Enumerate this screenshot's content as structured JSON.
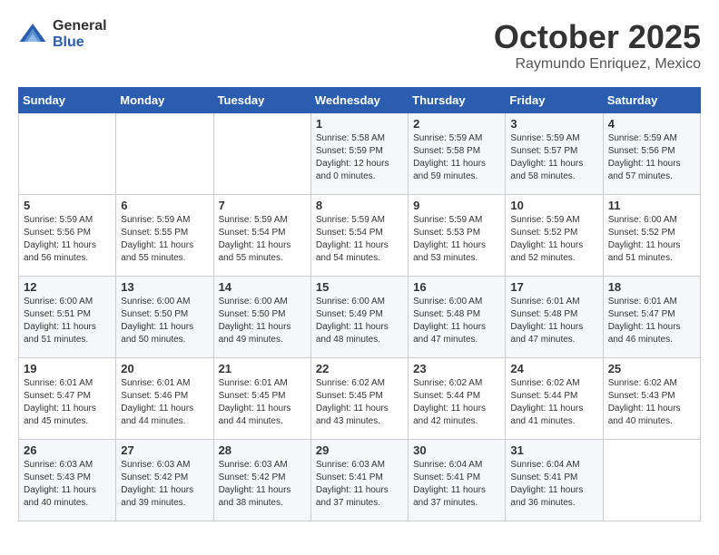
{
  "header": {
    "logo_general": "General",
    "logo_blue": "Blue",
    "month": "October 2025",
    "location": "Raymundo Enriquez, Mexico"
  },
  "days_of_week": [
    "Sunday",
    "Monday",
    "Tuesday",
    "Wednesday",
    "Thursday",
    "Friday",
    "Saturday"
  ],
  "weeks": [
    [
      {
        "day": "",
        "sunrise": "",
        "sunset": "",
        "daylight": ""
      },
      {
        "day": "",
        "sunrise": "",
        "sunset": "",
        "daylight": ""
      },
      {
        "day": "",
        "sunrise": "",
        "sunset": "",
        "daylight": ""
      },
      {
        "day": "1",
        "sunrise": "Sunrise: 5:58 AM",
        "sunset": "Sunset: 5:59 PM",
        "daylight": "Daylight: 12 hours and 0 minutes."
      },
      {
        "day": "2",
        "sunrise": "Sunrise: 5:59 AM",
        "sunset": "Sunset: 5:58 PM",
        "daylight": "Daylight: 11 hours and 59 minutes."
      },
      {
        "day": "3",
        "sunrise": "Sunrise: 5:59 AM",
        "sunset": "Sunset: 5:57 PM",
        "daylight": "Daylight: 11 hours and 58 minutes."
      },
      {
        "day": "4",
        "sunrise": "Sunrise: 5:59 AM",
        "sunset": "Sunset: 5:56 PM",
        "daylight": "Daylight: 11 hours and 57 minutes."
      }
    ],
    [
      {
        "day": "5",
        "sunrise": "Sunrise: 5:59 AM",
        "sunset": "Sunset: 5:56 PM",
        "daylight": "Daylight: 11 hours and 56 minutes."
      },
      {
        "day": "6",
        "sunrise": "Sunrise: 5:59 AM",
        "sunset": "Sunset: 5:55 PM",
        "daylight": "Daylight: 11 hours and 55 minutes."
      },
      {
        "day": "7",
        "sunrise": "Sunrise: 5:59 AM",
        "sunset": "Sunset: 5:54 PM",
        "daylight": "Daylight: 11 hours and 55 minutes."
      },
      {
        "day": "8",
        "sunrise": "Sunrise: 5:59 AM",
        "sunset": "Sunset: 5:54 PM",
        "daylight": "Daylight: 11 hours and 54 minutes."
      },
      {
        "day": "9",
        "sunrise": "Sunrise: 5:59 AM",
        "sunset": "Sunset: 5:53 PM",
        "daylight": "Daylight: 11 hours and 53 minutes."
      },
      {
        "day": "10",
        "sunrise": "Sunrise: 5:59 AM",
        "sunset": "Sunset: 5:52 PM",
        "daylight": "Daylight: 11 hours and 52 minutes."
      },
      {
        "day": "11",
        "sunrise": "Sunrise: 6:00 AM",
        "sunset": "Sunset: 5:52 PM",
        "daylight": "Daylight: 11 hours and 51 minutes."
      }
    ],
    [
      {
        "day": "12",
        "sunrise": "Sunrise: 6:00 AM",
        "sunset": "Sunset: 5:51 PM",
        "daylight": "Daylight: 11 hours and 51 minutes."
      },
      {
        "day": "13",
        "sunrise": "Sunrise: 6:00 AM",
        "sunset": "Sunset: 5:50 PM",
        "daylight": "Daylight: 11 hours and 50 minutes."
      },
      {
        "day": "14",
        "sunrise": "Sunrise: 6:00 AM",
        "sunset": "Sunset: 5:50 PM",
        "daylight": "Daylight: 11 hours and 49 minutes."
      },
      {
        "day": "15",
        "sunrise": "Sunrise: 6:00 AM",
        "sunset": "Sunset: 5:49 PM",
        "daylight": "Daylight: 11 hours and 48 minutes."
      },
      {
        "day": "16",
        "sunrise": "Sunrise: 6:00 AM",
        "sunset": "Sunset: 5:48 PM",
        "daylight": "Daylight: 11 hours and 47 minutes."
      },
      {
        "day": "17",
        "sunrise": "Sunrise: 6:01 AM",
        "sunset": "Sunset: 5:48 PM",
        "daylight": "Daylight: 11 hours and 47 minutes."
      },
      {
        "day": "18",
        "sunrise": "Sunrise: 6:01 AM",
        "sunset": "Sunset: 5:47 PM",
        "daylight": "Daylight: 11 hours and 46 minutes."
      }
    ],
    [
      {
        "day": "19",
        "sunrise": "Sunrise: 6:01 AM",
        "sunset": "Sunset: 5:47 PM",
        "daylight": "Daylight: 11 hours and 45 minutes."
      },
      {
        "day": "20",
        "sunrise": "Sunrise: 6:01 AM",
        "sunset": "Sunset: 5:46 PM",
        "daylight": "Daylight: 11 hours and 44 minutes."
      },
      {
        "day": "21",
        "sunrise": "Sunrise: 6:01 AM",
        "sunset": "Sunset: 5:45 PM",
        "daylight": "Daylight: 11 hours and 44 minutes."
      },
      {
        "day": "22",
        "sunrise": "Sunrise: 6:02 AM",
        "sunset": "Sunset: 5:45 PM",
        "daylight": "Daylight: 11 hours and 43 minutes."
      },
      {
        "day": "23",
        "sunrise": "Sunrise: 6:02 AM",
        "sunset": "Sunset: 5:44 PM",
        "daylight": "Daylight: 11 hours and 42 minutes."
      },
      {
        "day": "24",
        "sunrise": "Sunrise: 6:02 AM",
        "sunset": "Sunset: 5:44 PM",
        "daylight": "Daylight: 11 hours and 41 minutes."
      },
      {
        "day": "25",
        "sunrise": "Sunrise: 6:02 AM",
        "sunset": "Sunset: 5:43 PM",
        "daylight": "Daylight: 11 hours and 40 minutes."
      }
    ],
    [
      {
        "day": "26",
        "sunrise": "Sunrise: 6:03 AM",
        "sunset": "Sunset: 5:43 PM",
        "daylight": "Daylight: 11 hours and 40 minutes."
      },
      {
        "day": "27",
        "sunrise": "Sunrise: 6:03 AM",
        "sunset": "Sunset: 5:42 PM",
        "daylight": "Daylight: 11 hours and 39 minutes."
      },
      {
        "day": "28",
        "sunrise": "Sunrise: 6:03 AM",
        "sunset": "Sunset: 5:42 PM",
        "daylight": "Daylight: 11 hours and 38 minutes."
      },
      {
        "day": "29",
        "sunrise": "Sunrise: 6:03 AM",
        "sunset": "Sunset: 5:41 PM",
        "daylight": "Daylight: 11 hours and 37 minutes."
      },
      {
        "day": "30",
        "sunrise": "Sunrise: 6:04 AM",
        "sunset": "Sunset: 5:41 PM",
        "daylight": "Daylight: 11 hours and 37 minutes."
      },
      {
        "day": "31",
        "sunrise": "Sunrise: 6:04 AM",
        "sunset": "Sunset: 5:41 PM",
        "daylight": "Daylight: 11 hours and 36 minutes."
      },
      {
        "day": "",
        "sunrise": "",
        "sunset": "",
        "daylight": ""
      }
    ]
  ]
}
